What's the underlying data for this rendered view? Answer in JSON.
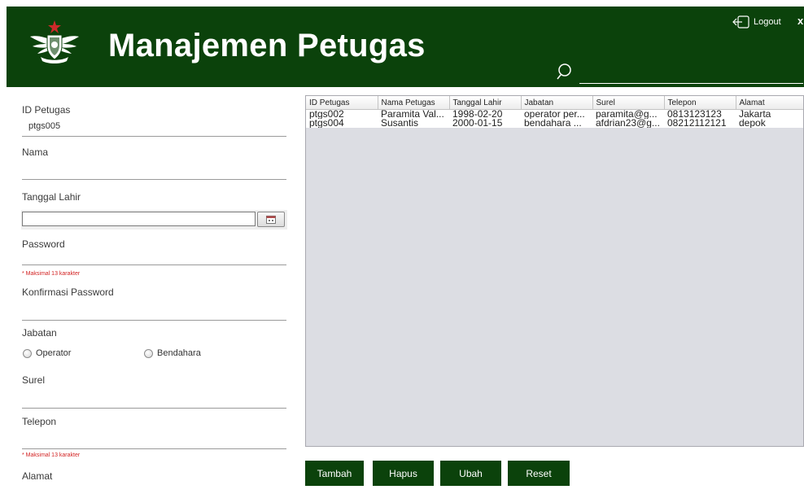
{
  "header": {
    "title": "Manajemen Petugas",
    "logout_label": "Logout",
    "close_label": "x",
    "search": {
      "value": "",
      "placeholder": ""
    }
  },
  "colors": {
    "header_bg": "#0b420b",
    "button_bg": "#0b420b",
    "warning_text": "#d22222",
    "table_bg": "#dcdde3"
  },
  "form": {
    "id_label": "ID Petugas",
    "id_value": "ptgs005",
    "nama_label": "Nama",
    "nama_value": "",
    "tanggal_label": "Tanggal Lahir",
    "tanggal_value": "",
    "password_label": "Password",
    "password_note": "* Maksimal 13 karakter",
    "konfirmasi_label": "Konfirmasi Password",
    "jabatan_label": "Jabatan",
    "jabatan_options": [
      "Operator",
      "Bendahara"
    ],
    "surel_label": "Surel",
    "telepon_label": "Telepon",
    "telepon_note": "* Maksimal 13 karakter",
    "alamat_label": "Alamat"
  },
  "table": {
    "columns": [
      "ID Petugas",
      "Nama Petugas",
      "Tanggal Lahir",
      "Jabatan",
      "Surel",
      "Telepon",
      "Alamat"
    ],
    "rows": [
      [
        "ptgs002",
        "Paramita Val...",
        "1998-02-20",
        "operator per...",
        "paramita@g...",
        "0813123123",
        "Jakarta"
      ],
      [
        "ptgs004",
        "Susantis",
        "2000-01-15",
        "bendahara ...",
        "afdrian23@g...",
        "08212112121",
        "depok"
      ]
    ]
  },
  "buttons": {
    "tambah": "Tambah",
    "hapus": "Hapus",
    "ubah": "Ubah",
    "reset": "Reset"
  },
  "icons": {
    "logo": "emblem-logo-icon",
    "logout": "logout-icon",
    "search": "search-icon",
    "calendar": "calendar-icon"
  }
}
